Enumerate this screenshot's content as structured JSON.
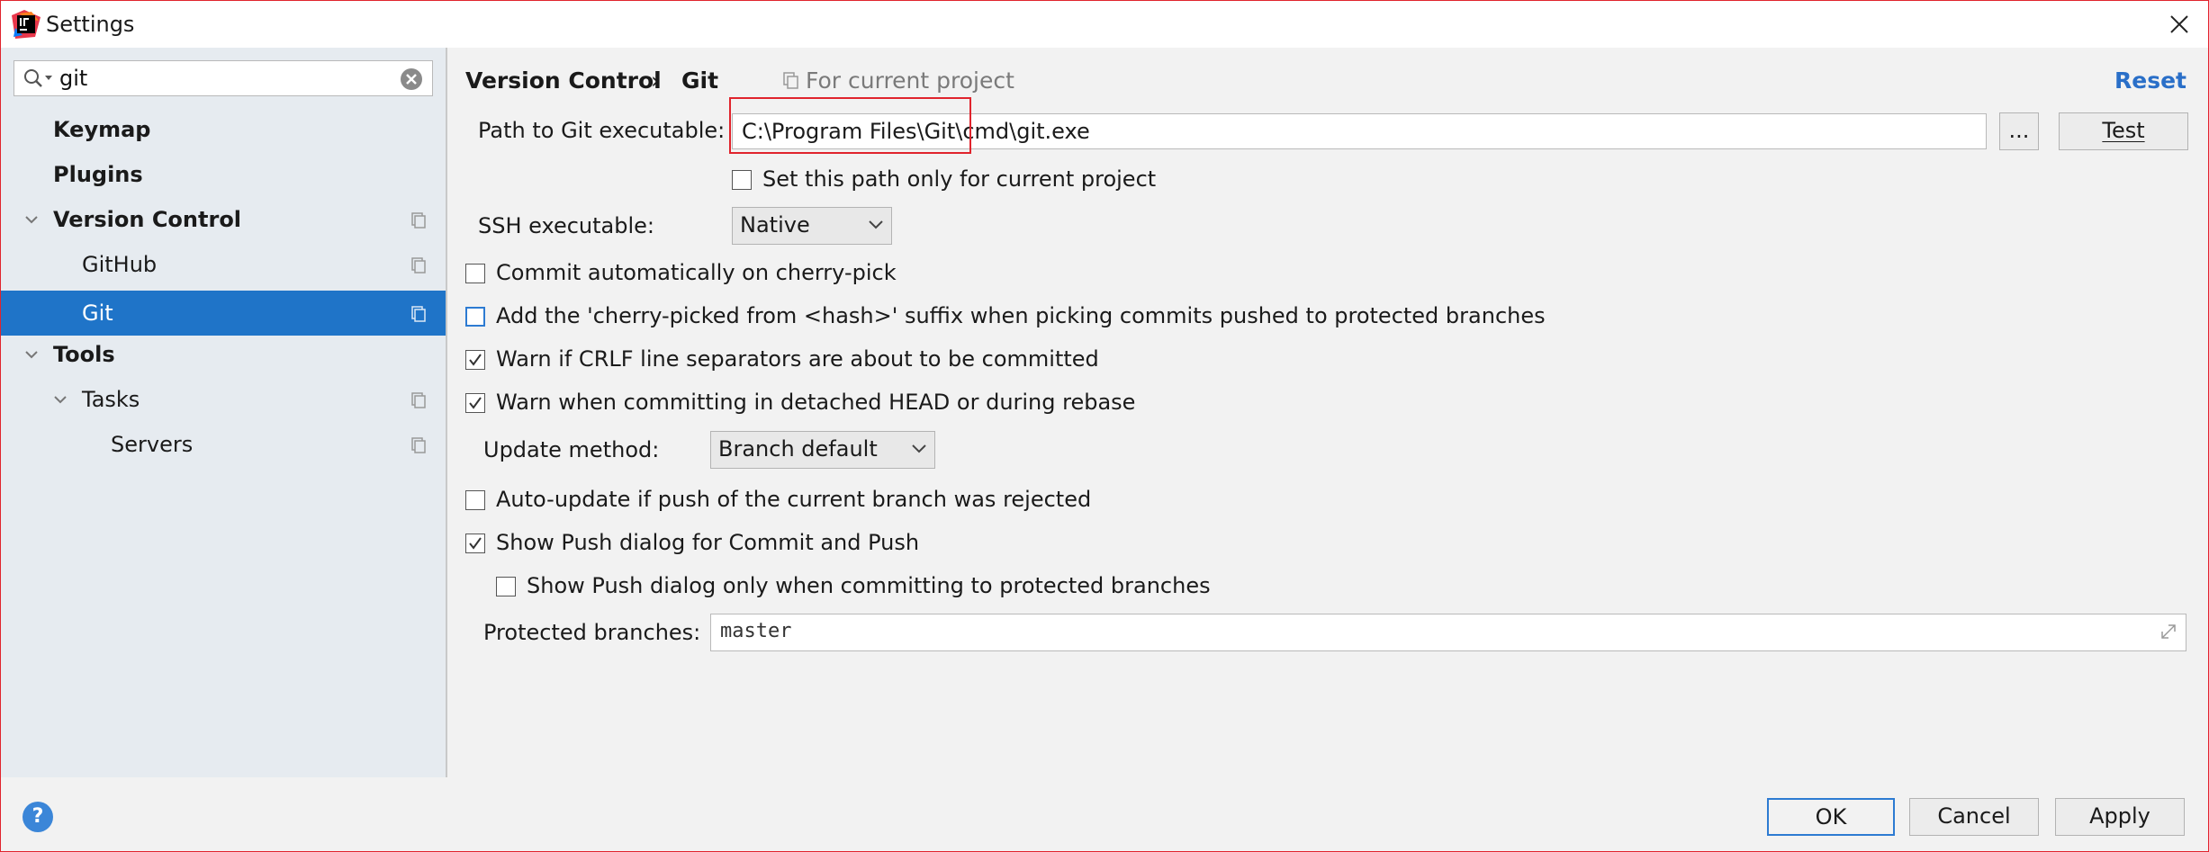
{
  "window": {
    "title": "Settings"
  },
  "search": {
    "value": "git",
    "placeholder": ""
  },
  "sidebar": {
    "items": [
      {
        "label": "Keymap"
      },
      {
        "label": "Plugins"
      },
      {
        "label": "Version Control"
      },
      {
        "label": "GitHub"
      },
      {
        "label": "Git"
      },
      {
        "label": "Tools"
      },
      {
        "label": "Tasks"
      },
      {
        "label": "Servers"
      }
    ]
  },
  "breadcrumb": {
    "section": "Version Control",
    "separator": "›",
    "page": "Git",
    "scope": "For current project"
  },
  "header": {
    "reset": "Reset"
  },
  "git_path": {
    "label": "Path to Git executable:",
    "value": "C:\\Program Files\\Git\\cmd\\git.exe",
    "browse": "...",
    "test": "Test"
  },
  "current_project_only": {
    "label": "Set this path only for current project",
    "checked": false
  },
  "ssh": {
    "label": "SSH executable:",
    "value": "Native"
  },
  "options": {
    "cherry_pick_commit": {
      "label": "Commit automatically on cherry-pick",
      "checked": false
    },
    "cherry_picked_suffix": {
      "label": "Add the 'cherry-picked from <hash>' suffix when picking commits pushed to protected branches",
      "checked": false
    },
    "warn_crlf": {
      "label": "Warn if CRLF line separators are about to be committed",
      "checked": true
    },
    "warn_detached": {
      "label": "Warn when committing in detached HEAD or during rebase",
      "checked": true
    },
    "auto_update": {
      "label": "Auto-update if push of the current branch was rejected",
      "checked": false
    },
    "show_push_dialog": {
      "label": "Show Push dialog for Commit and Push",
      "checked": true
    },
    "push_dialog_protected": {
      "label": "Show Push dialog only when committing to protected branches",
      "checked": false
    }
  },
  "update_method": {
    "label": "Update method:",
    "value": "Branch default"
  },
  "protected_branches": {
    "label": "Protected branches:",
    "value": "master"
  },
  "footer": {
    "ok": "OK",
    "cancel": "Cancel",
    "apply": "Apply",
    "help": "?"
  },
  "colors": {
    "selection": "#1f74c8",
    "highlight_border": "#e0242d",
    "link": "#2a6fc8"
  }
}
